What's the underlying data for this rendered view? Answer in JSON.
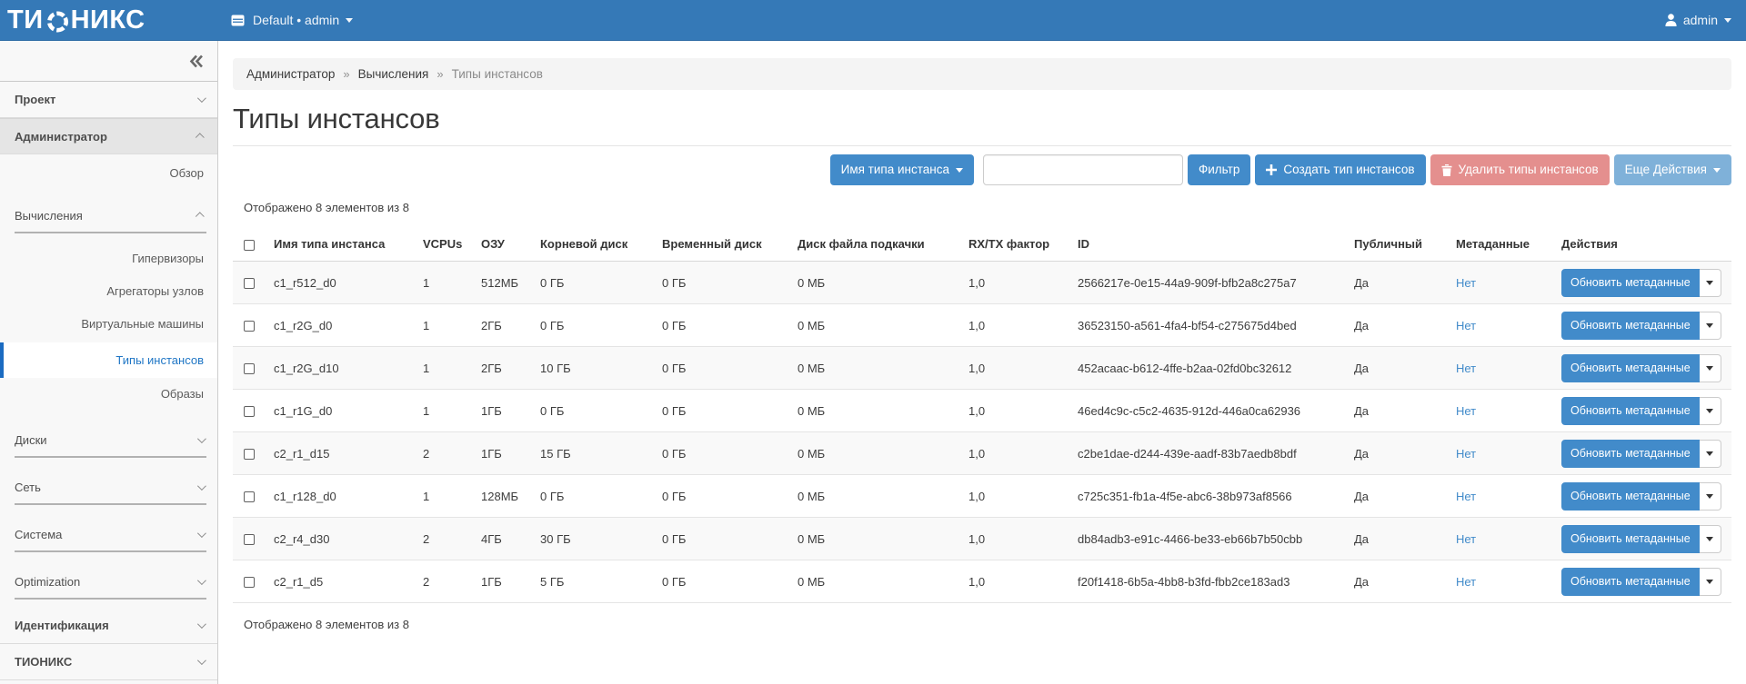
{
  "navbar": {
    "brand_prefix": "ТИ",
    "brand_suffix": "НИКС",
    "context_label": "Default • admin",
    "user_label": "admin"
  },
  "sidebar": {
    "sections": [
      {
        "label": "Проект",
        "state": "collapsed"
      },
      {
        "label": "Администратор",
        "state": "expanded"
      },
      {
        "label": "Идентификация",
        "state": "collapsed"
      },
      {
        "label": "ТИОНИКС",
        "state": "collapsed"
      }
    ],
    "admin_panel": {
      "links": [
        {
          "label": "Обзор",
          "active": false
        }
      ],
      "groups": [
        {
          "label": "Вычисления",
          "state": "expanded",
          "items": [
            {
              "label": "Гипервизоры",
              "active": false
            },
            {
              "label": "Агрегаторы узлов",
              "active": false
            },
            {
              "label": "Виртуальные машины",
              "active": false
            },
            {
              "label": "Типы инстансов",
              "active": true
            },
            {
              "label": "Образы",
              "active": false
            }
          ]
        },
        {
          "label": "Диски",
          "state": "collapsed",
          "items": []
        },
        {
          "label": "Сеть",
          "state": "collapsed",
          "items": []
        },
        {
          "label": "Система",
          "state": "collapsed",
          "items": []
        },
        {
          "label": "Optimization",
          "state": "collapsed",
          "items": []
        }
      ]
    }
  },
  "breadcrumb": {
    "items": [
      "Администратор",
      "Вычисления"
    ],
    "current": "Типы инстансов",
    "separator": "»"
  },
  "page": {
    "title": "Типы инстансов"
  },
  "filters": {
    "field_selector_label": "Имя типа инстанса",
    "search_value": "",
    "filter_button": "Фильтр",
    "create_button": "Создать тип инстансов",
    "delete_button": "Удалить типы инстансов",
    "more_button": "Еще Действия"
  },
  "table": {
    "shown_count": "Отображено 8 элементов из 8",
    "columns": [
      "Имя типа инстанса",
      "VCPUs",
      "ОЗУ",
      "Корневой диск",
      "Временный диск",
      "Диск файла подкачки",
      "RX/TX фактор",
      "ID",
      "Публичный",
      "Метаданные",
      "Действия"
    ],
    "row_action_label": "Обновить метаданные",
    "rows": [
      {
        "name": "c1_r512_d0",
        "vcpus": "1",
        "ram": "512МБ",
        "root_disk": "0 ГБ",
        "ephemeral_disk": "0 ГБ",
        "swap_disk": "0 МБ",
        "rxtx": "1,0",
        "id": "2566217e-0e15-44a9-909f-bfb2a8c275a7",
        "public": "Да",
        "metadata": "Нет"
      },
      {
        "name": "c1_r2G_d0",
        "vcpus": "1",
        "ram": "2ГБ",
        "root_disk": "0 ГБ",
        "ephemeral_disk": "0 ГБ",
        "swap_disk": "0 МБ",
        "rxtx": "1,0",
        "id": "36523150-a561-4fa4-bf54-c275675d4bed",
        "public": "Да",
        "metadata": "Нет"
      },
      {
        "name": "c1_r2G_d10",
        "vcpus": "1",
        "ram": "2ГБ",
        "root_disk": "10 ГБ",
        "ephemeral_disk": "0 ГБ",
        "swap_disk": "0 МБ",
        "rxtx": "1,0",
        "id": "452acaac-b612-4ffe-b2aa-02fd0bc32612",
        "public": "Да",
        "metadata": "Нет"
      },
      {
        "name": "c1_r1G_d0",
        "vcpus": "1",
        "ram": "1ГБ",
        "root_disk": "0 ГБ",
        "ephemeral_disk": "0 ГБ",
        "swap_disk": "0 МБ",
        "rxtx": "1,0",
        "id": "46ed4c9c-c5c2-4635-912d-446a0ca62936",
        "public": "Да",
        "metadata": "Нет"
      },
      {
        "name": "c2_r1_d15",
        "vcpus": "2",
        "ram": "1ГБ",
        "root_disk": "15 ГБ",
        "ephemeral_disk": "0 ГБ",
        "swap_disk": "0 МБ",
        "rxtx": "1,0",
        "id": "c2be1dae-d244-439e-aadf-83b7aedb8bdf",
        "public": "Да",
        "metadata": "Нет"
      },
      {
        "name": "c1_r128_d0",
        "vcpus": "1",
        "ram": "128МБ",
        "root_disk": "0 ГБ",
        "ephemeral_disk": "0 ГБ",
        "swap_disk": "0 МБ",
        "rxtx": "1,0",
        "id": "c725c351-fb1a-4f5e-abc6-38b973af8566",
        "public": "Да",
        "metadata": "Нет"
      },
      {
        "name": "c2_r4_d30",
        "vcpus": "2",
        "ram": "4ГБ",
        "root_disk": "30 ГБ",
        "ephemeral_disk": "0 ГБ",
        "swap_disk": "0 МБ",
        "rxtx": "1,0",
        "id": "db84adb3-e91c-4466-be33-eb66b7b50cbb",
        "public": "Да",
        "metadata": "Нет"
      },
      {
        "name": "c2_r1_d5",
        "vcpus": "2",
        "ram": "1ГБ",
        "root_disk": "5 ГБ",
        "ephemeral_disk": "0 ГБ",
        "swap_disk": "0 МБ",
        "rxtx": "1,0",
        "id": "f20f1418-6b5a-4bb8-b3fd-fbb2ce183ad3",
        "public": "Да",
        "metadata": "Нет"
      }
    ]
  },
  "colors": {
    "navbar": "#3579b7",
    "primary_button": "#428bca",
    "danger_button": "#e48f8e",
    "info_button": "#7fb1d9",
    "active_link": "#1f76c5"
  }
}
